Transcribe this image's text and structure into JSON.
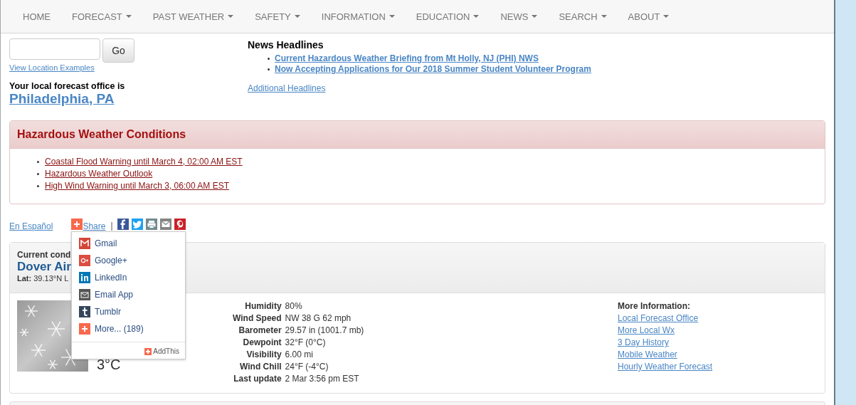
{
  "nav": [
    {
      "label": "HOME",
      "dropdown": false
    },
    {
      "label": "FORECAST",
      "dropdown": true
    },
    {
      "label": "PAST WEATHER",
      "dropdown": true
    },
    {
      "label": "SAFETY",
      "dropdown": true
    },
    {
      "label": "INFORMATION",
      "dropdown": true
    },
    {
      "label": "EDUCATION",
      "dropdown": true
    },
    {
      "label": "NEWS",
      "dropdown": true
    },
    {
      "label": "SEARCH",
      "dropdown": true
    },
    {
      "label": "ABOUT",
      "dropdown": true
    }
  ],
  "location": {
    "button": "Go",
    "examples_link": "View Location Examples",
    "office_label": "Your local forecast office is",
    "office": "Philadelphia, PA"
  },
  "news": {
    "title": "News Headlines",
    "items": [
      "Current Hazardous Weather Briefing from Mt Holly, NJ (PHI) NWS",
      "Now Accepting Applications for Our 2018 Summer Student Volunteer Program"
    ],
    "more": "Additional Headlines"
  },
  "hazards": {
    "title": "Hazardous Weather Conditions",
    "items": [
      "Coastal Flood Warning until March 4, 02:00 AM EST",
      "Hazardous Weather Outlook",
      "High Wind Warning until March 3, 06:00 AM EST"
    ]
  },
  "language_link": "En Español",
  "share": {
    "label": "Share",
    "separator": "|",
    "menu": [
      {
        "kind": "gmail",
        "label": "Gmail"
      },
      {
        "kind": "googleplus",
        "label": "Google+"
      },
      {
        "kind": "linkedin",
        "label": "LinkedIn"
      },
      {
        "kind": "emailapp",
        "label": "Email App"
      },
      {
        "kind": "tumblr",
        "label": "Tumblr"
      },
      {
        "kind": "more",
        "label": "More... (189)"
      }
    ],
    "footer": "AddThis"
  },
  "conditions": {
    "heading": "Current cond",
    "station": "Dover Air",
    "coords": "**Lat:** 39.13°N  L",
    "temp_c": "3°C",
    "details": [
      {
        "label": "Humidity",
        "value": "80%"
      },
      {
        "label": "Wind Speed",
        "value": "NW 38 G 62 mph"
      },
      {
        "label": "Barometer",
        "value": "29.57 in (1001.7 mb)"
      },
      {
        "label": "Dewpoint",
        "value": "32°F (0°C)"
      },
      {
        "label": "Visibility",
        "value": "6.00 mi"
      },
      {
        "label": "Wind Chill",
        "value": "24°F (-4°C)"
      },
      {
        "label": "Last update",
        "value": "2 Mar 3:56 pm EST"
      }
    ],
    "more_title": "More Information:",
    "more_links": [
      "Local Forecast Office",
      "More Local Wx",
      "3 Day History",
      "Mobile Weather",
      "Hourly Weather Forecast"
    ]
  }
}
